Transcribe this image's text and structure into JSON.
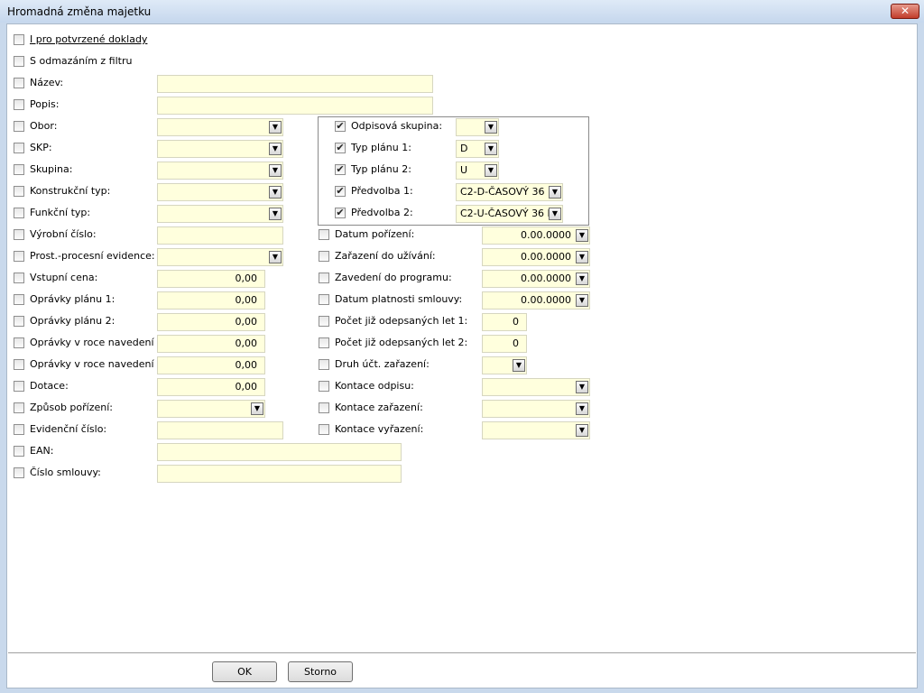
{
  "window": {
    "title": "Hromadná změna majetku",
    "close_glyph": "✕"
  },
  "left": {
    "only_confirmed": {
      "checked": false,
      "label": "I pro potvrzené doklady"
    },
    "filter_discard": {
      "checked": false,
      "label": "S odmazáním z filtru"
    },
    "nazev": {
      "checked": false,
      "label": "Název:",
      "value": ""
    },
    "popis": {
      "checked": false,
      "label": "Popis:",
      "value": ""
    },
    "obor": {
      "checked": false,
      "label": "Obor:",
      "value": ""
    },
    "skp": {
      "checked": false,
      "label": "SKP:",
      "value": ""
    },
    "skupina": {
      "checked": false,
      "label": "Skupina:",
      "value": ""
    },
    "konstrukcni_typ": {
      "checked": false,
      "label": "Konstrukční typ:",
      "value": ""
    },
    "funkcni_typ": {
      "checked": false,
      "label": "Funkční typ:",
      "value": ""
    },
    "vyrobni_cislo": {
      "checked": false,
      "label": "Výrobní číslo:",
      "value": ""
    },
    "prost_procesni": {
      "checked": false,
      "label": "Prost.-procesní evidence:",
      "value": ""
    },
    "vstupni_cena": {
      "checked": false,
      "label": "Vstupní cena:",
      "value": "0,00"
    },
    "opravky_planu_1": {
      "checked": false,
      "label": "Oprávky plánu 1:",
      "value": "0,00"
    },
    "opravky_planu_2": {
      "checked": false,
      "label": "Oprávky plánu 2:",
      "value": "0,00"
    },
    "opravky_roce_1": {
      "checked": false,
      "label": "Oprávky v roce navedení 1:",
      "value": "0,00"
    },
    "opravky_roce_2": {
      "checked": false,
      "label": "Oprávky v roce navedení 2:",
      "value": "0,00"
    },
    "dotace": {
      "checked": false,
      "label": "Dotace:",
      "value": "0,00"
    },
    "zpusob_porizeni": {
      "checked": false,
      "label": "Způsob pořízení:",
      "value": ""
    },
    "evidencni_cislo": {
      "checked": false,
      "label": "Evidenční číslo:",
      "value": ""
    },
    "ean": {
      "checked": false,
      "label": "EAN:",
      "value": ""
    },
    "cislo_smlouvy": {
      "checked": false,
      "label": "Číslo smlouvy:",
      "value": ""
    }
  },
  "plan_box": {
    "odpisova_skupina": {
      "checked": true,
      "label": "Odpisová skupina:",
      "value": ""
    },
    "typ_planu_1": {
      "checked": true,
      "label": "Typ plánu 1:",
      "value": "D"
    },
    "typ_planu_2": {
      "checked": true,
      "label": "Typ plánu 2:",
      "value": "U"
    },
    "predvolba_1": {
      "checked": true,
      "label": "Předvolba 1:",
      "value": "C2-D-ČASOVÝ 36 M"
    },
    "predvolba_2": {
      "checked": true,
      "label": "Předvolba 2:",
      "value": "C2-U-ČASOVÝ 36 M"
    }
  },
  "right": {
    "datum_porizeni": {
      "checked": false,
      "label": "Datum pořízení:",
      "value": "0.00.0000"
    },
    "zarazeni_uzivani": {
      "checked": false,
      "label": "Zařazení do užívání:",
      "value": "0.00.0000"
    },
    "zavedeni_programu": {
      "checked": false,
      "label": "Zavedení do programu:",
      "value": "0.00.0000"
    },
    "datum_platnosti": {
      "checked": false,
      "label": "Datum platnosti smlouvy:",
      "value": "0.00.0000"
    },
    "pocet_let_1": {
      "checked": false,
      "label": "Počet již odepsaných let 1:",
      "value": "0"
    },
    "pocet_let_2": {
      "checked": false,
      "label": "Počet již odepsaných let 2:",
      "value": "0"
    },
    "druh_uct": {
      "checked": false,
      "label": "Druh účt. zařazení:",
      "value": ""
    },
    "kontace_odpisu": {
      "checked": false,
      "label": "Kontace odpisu:",
      "value": ""
    },
    "kontace_zarazeni": {
      "checked": false,
      "label": "Kontace zařazení:",
      "value": ""
    },
    "kontace_vyrazeni": {
      "checked": false,
      "label": "Kontace vyřazení:",
      "value": ""
    }
  },
  "glyphs": {
    "check": "✔",
    "unchecked": "",
    "dropdown_arrow": "▼"
  },
  "buttons": {
    "ok": "OK",
    "cancel": "Storno"
  },
  "colors": {
    "field_bg": "#ffffdd",
    "titlebar": "#c6d7ed",
    "close": "#c23c2b"
  }
}
